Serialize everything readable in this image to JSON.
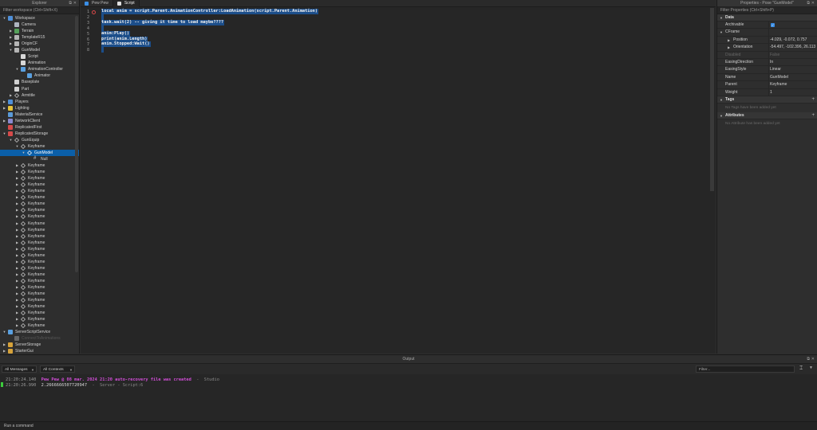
{
  "explorer": {
    "title": "Explorer",
    "filter_placeholder": "Filter workspace (Ctrl+Shift+X)",
    "items": [
      {
        "label": "Workspace",
        "depth": 0,
        "arrow": "▼",
        "icon": "workspace-icon",
        "color": "#4f8fd8"
      },
      {
        "label": "Camera",
        "depth": 1,
        "arrow": "",
        "icon": "camera-icon",
        "color": "#aeb4c0"
      },
      {
        "label": "Terrain",
        "depth": 1,
        "arrow": "▶",
        "icon": "terrain-icon",
        "color": "#55a05a"
      },
      {
        "label": "TemplateR15",
        "depth": 1,
        "arrow": "▶",
        "icon": "model-icon",
        "color": "#b5b5b5"
      },
      {
        "label": "OriginCF",
        "depth": 1,
        "arrow": "▶",
        "icon": "model-icon",
        "color": "#b5b5b5"
      },
      {
        "label": "GunModel",
        "depth": 1,
        "arrow": "▼",
        "icon": "model-icon",
        "color": "#b5b5b5"
      },
      {
        "label": "Script",
        "depth": 2,
        "arrow": "",
        "icon": "script-icon",
        "color": "#d8d8d8"
      },
      {
        "label": "Animation",
        "depth": 2,
        "arrow": "",
        "icon": "animation-icon",
        "color": "#d8d8d8"
      },
      {
        "label": "AnimationController",
        "depth": 2,
        "arrow": "▼",
        "icon": "animation-controller-icon",
        "color": "#5aa0e0"
      },
      {
        "label": "Animator",
        "depth": 3,
        "arrow": "",
        "icon": "animator-icon",
        "color": "#5aa0e0"
      },
      {
        "label": "Baseplate",
        "depth": 1,
        "arrow": "",
        "icon": "part-icon",
        "color": "#d0d0d0"
      },
      {
        "label": "Part",
        "depth": 1,
        "arrow": "",
        "icon": "part-icon",
        "color": "#d0d0d0"
      },
      {
        "label": "Armtitle",
        "depth": 1,
        "arrow": "▶",
        "icon": "keyframe-icon",
        "color": "#d0d0d0"
      },
      {
        "label": "Players",
        "depth": 0,
        "arrow": "▶",
        "icon": "players-icon",
        "color": "#4f8fd8"
      },
      {
        "label": "Lighting",
        "depth": 0,
        "arrow": "▶",
        "icon": "lighting-icon",
        "color": "#e6c23a"
      },
      {
        "label": "MaterialService",
        "depth": 0,
        "arrow": "",
        "icon": "material-service-icon",
        "color": "#5a9ad8"
      },
      {
        "label": "NetworkClient",
        "depth": 0,
        "arrow": "▶",
        "icon": "network-client-icon",
        "color": "#8a8ad0"
      },
      {
        "label": "ReplicatedFirst",
        "depth": 0,
        "arrow": "",
        "icon": "replicated-first-icon",
        "color": "#d64a4a"
      },
      {
        "label": "ReplicatedStorage",
        "depth": 0,
        "arrow": "▼",
        "icon": "replicated-storage-icon",
        "color": "#d64a4a"
      },
      {
        "label": "GunEquip",
        "depth": 1,
        "arrow": "▼",
        "icon": "keyframe-sequence-icon",
        "color": "#d0d0d0"
      },
      {
        "label": "Keyframe",
        "depth": 2,
        "arrow": "▼",
        "icon": "keyframe-icon",
        "color": "#d0d0d0"
      },
      {
        "label": "GunModel",
        "depth": 3,
        "arrow": "▼",
        "icon": "pose-icon",
        "color": "#ffffff",
        "selected": true
      },
      {
        "label": "Null",
        "depth": 4,
        "arrow": "",
        "icon": "number-value-icon",
        "color": "#d0d0d0"
      },
      {
        "label": "Keyframe",
        "depth": 2,
        "arrow": "▶",
        "icon": "keyframe-icon",
        "color": "#d0d0d0"
      },
      {
        "label": "Keyframe",
        "depth": 2,
        "arrow": "▶",
        "icon": "keyframe-icon",
        "color": "#d0d0d0"
      },
      {
        "label": "Keyframe",
        "depth": 2,
        "arrow": "▶",
        "icon": "keyframe-icon",
        "color": "#d0d0d0"
      },
      {
        "label": "Keyframe",
        "depth": 2,
        "arrow": "▶",
        "icon": "keyframe-icon",
        "color": "#d0d0d0"
      },
      {
        "label": "Keyframe",
        "depth": 2,
        "arrow": "▶",
        "icon": "keyframe-icon",
        "color": "#d0d0d0"
      },
      {
        "label": "Keyframe",
        "depth": 2,
        "arrow": "▶",
        "icon": "keyframe-icon",
        "color": "#d0d0d0"
      },
      {
        "label": "Keyframe",
        "depth": 2,
        "arrow": "▶",
        "icon": "keyframe-icon",
        "color": "#d0d0d0"
      },
      {
        "label": "Keyframe",
        "depth": 2,
        "arrow": "▶",
        "icon": "keyframe-icon",
        "color": "#d0d0d0"
      },
      {
        "label": "Keyframe",
        "depth": 2,
        "arrow": "▶",
        "icon": "keyframe-icon",
        "color": "#d0d0d0"
      },
      {
        "label": "Keyframe",
        "depth": 2,
        "arrow": "▶",
        "icon": "keyframe-icon",
        "color": "#d0d0d0"
      },
      {
        "label": "Keyframe",
        "depth": 2,
        "arrow": "▶",
        "icon": "keyframe-icon",
        "color": "#d0d0d0"
      },
      {
        "label": "Keyframe",
        "depth": 2,
        "arrow": "▶",
        "icon": "keyframe-icon",
        "color": "#d0d0d0"
      },
      {
        "label": "Keyframe",
        "depth": 2,
        "arrow": "▶",
        "icon": "keyframe-icon",
        "color": "#d0d0d0"
      },
      {
        "label": "Keyframe",
        "depth": 2,
        "arrow": "▶",
        "icon": "keyframe-icon",
        "color": "#d0d0d0"
      },
      {
        "label": "Keyframe",
        "depth": 2,
        "arrow": "▶",
        "icon": "keyframe-icon",
        "color": "#d0d0d0"
      },
      {
        "label": "Keyframe",
        "depth": 2,
        "arrow": "▶",
        "icon": "keyframe-icon",
        "color": "#d0d0d0"
      },
      {
        "label": "Keyframe",
        "depth": 2,
        "arrow": "▶",
        "icon": "keyframe-icon",
        "color": "#d0d0d0"
      },
      {
        "label": "Keyframe",
        "depth": 2,
        "arrow": "▶",
        "icon": "keyframe-icon",
        "color": "#d0d0d0"
      },
      {
        "label": "Keyframe",
        "depth": 2,
        "arrow": "▶",
        "icon": "keyframe-icon",
        "color": "#d0d0d0"
      },
      {
        "label": "Keyframe",
        "depth": 2,
        "arrow": "▶",
        "icon": "keyframe-icon",
        "color": "#d0d0d0"
      },
      {
        "label": "Keyframe",
        "depth": 2,
        "arrow": "▶",
        "icon": "keyframe-icon",
        "color": "#d0d0d0"
      },
      {
        "label": "Keyframe",
        "depth": 2,
        "arrow": "▶",
        "icon": "keyframe-icon",
        "color": "#d0d0d0"
      },
      {
        "label": "Keyframe",
        "depth": 2,
        "arrow": "▶",
        "icon": "keyframe-icon",
        "color": "#d0d0d0"
      },
      {
        "label": "Keyframe",
        "depth": 2,
        "arrow": "▶",
        "icon": "keyframe-icon",
        "color": "#d0d0d0"
      },
      {
        "label": "Keyframe",
        "depth": 2,
        "arrow": "▶",
        "icon": "keyframe-icon",
        "color": "#d0d0d0"
      },
      {
        "label": "Keyframe",
        "depth": 2,
        "arrow": "▶",
        "icon": "keyframe-icon",
        "color": "#d0d0d0"
      },
      {
        "label": "ServerScriptService",
        "depth": 0,
        "arrow": "▼",
        "icon": "server-script-service-icon",
        "color": "#5aa0e0"
      },
      {
        "label": "ConnectToAnimations",
        "depth": 1,
        "arrow": "",
        "icon": "script-icon",
        "color": "#666666",
        "dim": true
      },
      {
        "label": "ServerStorage",
        "depth": 0,
        "arrow": "▶",
        "icon": "server-storage-icon",
        "color": "#d6a23a"
      },
      {
        "label": "StarterGui",
        "depth": 0,
        "arrow": "▶",
        "icon": "starter-gui-icon",
        "color": "#d6a23a"
      }
    ]
  },
  "editor": {
    "tabs": [
      {
        "label": "Pew Pew",
        "active": false,
        "icon": "place-icon",
        "color": "#3a8ee6"
      },
      {
        "label": "Script",
        "active": true,
        "icon": "script-icon",
        "color": "#e0e0e0"
      }
    ],
    "code_lines": [
      "local anim = script.Parent.AnimationController:LoadAnimation(script.Parent.Animation)",
      "",
      "task.wait(2) -- giving it time to load maybe????",
      "",
      "anim:Play()",
      "print(anim.Length)",
      "anim.Stopped:Wait()",
      ""
    ],
    "line_numbers": [
      "1",
      "2",
      "3",
      "4",
      "5",
      "6",
      "7",
      "8"
    ]
  },
  "properties": {
    "title": "Properties - Pose \"GunModel\"",
    "filter_placeholder": "Filter Properties (Ctrl+Shift+P)",
    "data_section": "Data",
    "rows": [
      {
        "name": "Archivable",
        "value": "",
        "checkbox": true
      },
      {
        "name": "CFrame",
        "value": "",
        "group": true
      },
      {
        "name": "Position",
        "value": "-4.029, -0.072, 0.757",
        "child": true
      },
      {
        "name": "Orientation",
        "value": "-54.497, -102.396, 26.113",
        "child": true
      },
      {
        "name": "Disabled",
        "value": "False",
        "disabled": true
      },
      {
        "name": "EasingDirection",
        "value": "In"
      },
      {
        "name": "EasingStyle",
        "value": "Linear"
      },
      {
        "name": "Name",
        "value": "GunModel"
      },
      {
        "name": "Parent",
        "value": "Keyframe"
      },
      {
        "name": "Weight",
        "value": "1"
      }
    ],
    "tags_section": "Tags",
    "tags_empty": "No Tags have been added yet",
    "attributes_section": "Attributes",
    "attributes_empty": "No Attribute has been added yet"
  },
  "output": {
    "title": "Output",
    "messages_dropdown": "All Messages",
    "contexts_dropdown": "All Contexts",
    "filter_placeholder": "Filter...",
    "lines": [
      {
        "ts": "21:20:24.140",
        "text": "Pew Pew @ 08 mar. 2024 21:20 auto-recovery file was created",
        "source": "  -  Studio",
        "kind": "warn"
      },
      {
        "ts": "21:20:26.990",
        "text": "2.2666666507720947",
        "source": "  -  Server - Script:6",
        "kind": "normal"
      }
    ]
  },
  "command_bar": {
    "placeholder": "Run a command"
  },
  "colors": {
    "selection": "#0b5fa8",
    "code_highlight": "#1c4e8a",
    "warn_text": "#d24ed8",
    "checkbox": "#3a8ee6"
  }
}
